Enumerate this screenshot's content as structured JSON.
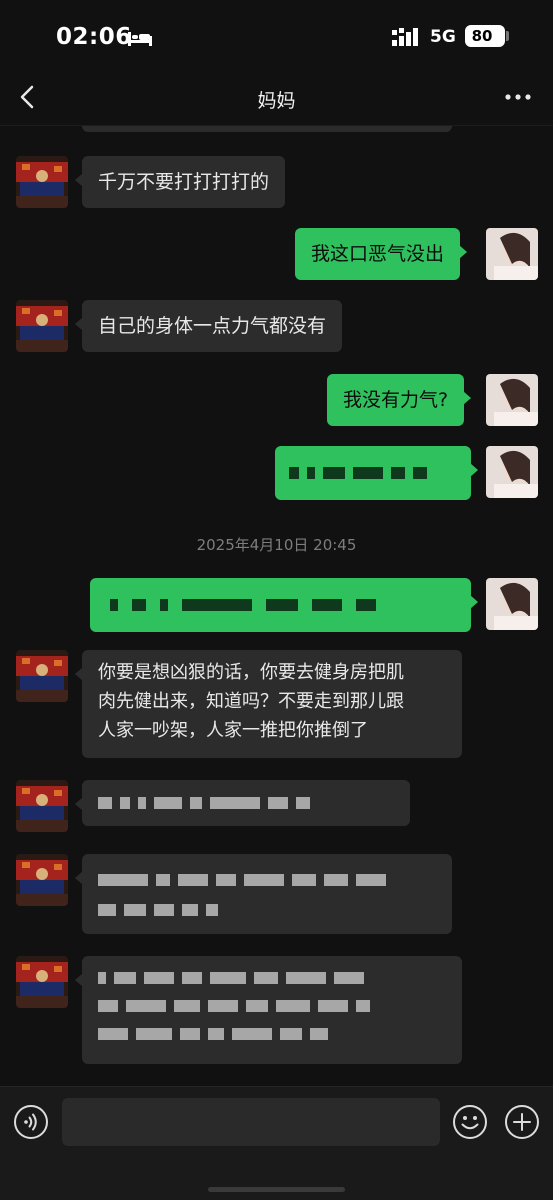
{
  "status_bar": {
    "time": "02:06",
    "network": "5G",
    "battery": "80"
  },
  "nav": {
    "title": "妈妈",
    "back_icon": "chevron-left-icon",
    "more_icon": "more-dots-icon"
  },
  "colors": {
    "background": "#111111",
    "incoming_bubble": "#2c2c2c",
    "outgoing_bubble": "#2fc15d",
    "timestamp": "#7d7d7d"
  },
  "messages": [
    {
      "sender": "mom",
      "text": "千万不要打打打打的"
    },
    {
      "sender": "me",
      "text": "我这口恶气没出"
    },
    {
      "sender": "mom",
      "text": "自己的身体一点力气都没有"
    },
    {
      "sender": "me",
      "text": "我没有力气?"
    },
    {
      "sender": "me",
      "text": "",
      "redacted": true
    },
    {
      "timestamp": "2025年4月10日 20:45"
    },
    {
      "sender": "me",
      "text": "",
      "redacted": true
    },
    {
      "sender": "mom",
      "lines": [
        "你要是想凶狠的话，你要去健身房把肌",
        "肉先健出来，知道吗？不要走到那儿跟",
        "人家一吵架，人家一推把你推倒了"
      ]
    },
    {
      "sender": "mom",
      "text": "",
      "redacted": true
    },
    {
      "sender": "mom",
      "text": "",
      "redacted": true
    },
    {
      "sender": "mom",
      "text": "",
      "redacted": true
    }
  ],
  "input_bar": {
    "voice_icon": "voice-icon",
    "emoji_icon": "emoji-icon",
    "plus_icon": "plus-icon"
  }
}
